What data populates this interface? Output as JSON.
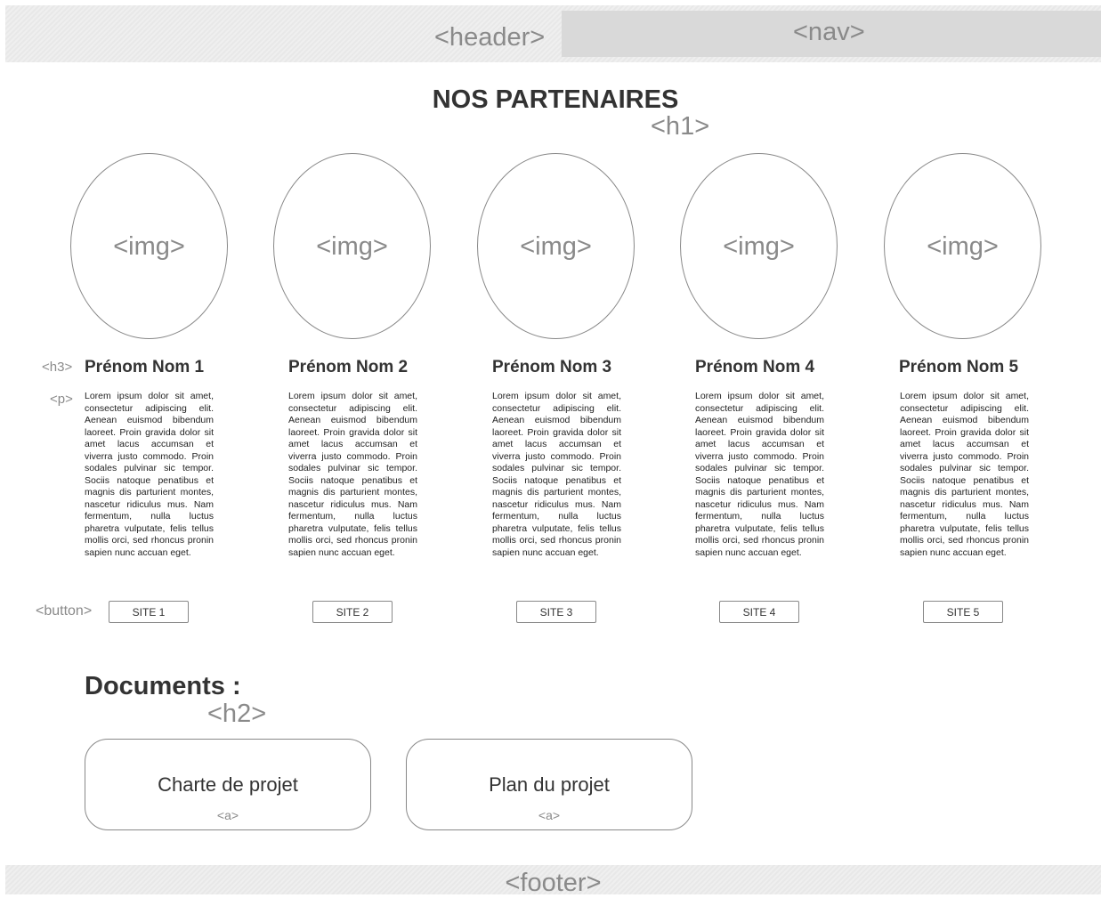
{
  "header": {
    "tag": "<header>"
  },
  "nav": {
    "tag": "<nav>"
  },
  "page": {
    "title": "NOS PARTENAIRES",
    "title_tag": "<h1>"
  },
  "annotations": {
    "h3": "<h3>",
    "p": "<p>",
    "button": "<button>"
  },
  "partners": [
    {
      "image_tag": "<img>",
      "name": "Prénom Nom 1",
      "text": "Lorem ipsum dolor sit amet, consectetur adipiscing elit. Aenean euismod bibendum laoreet. Proin gravida dolor sit amet lacus accumsan et viverra justo commodo. Proin sodales pulvinar sic tempor. Sociis natoque penatibus et magnis dis parturient montes, nascetur ridiculus mus. Nam fermentum, nulla luctus pharetra vulputate, felis tellus mollis orci, sed rhoncus pronin sapien nunc accuan eget.",
      "button": "SITE 1"
    },
    {
      "image_tag": "<img>",
      "name": "Prénom Nom 2",
      "text": "Lorem ipsum dolor sit amet, consectetur adipiscing elit. Aenean euismod bibendum laoreet. Proin gravida dolor sit amet lacus accumsan et viverra justo commodo. Proin sodales pulvinar sic tempor. Sociis natoque penatibus et magnis dis parturient montes, nascetur ridiculus mus. Nam fermentum, nulla luctus pharetra vulputate, felis tellus mollis orci, sed rhoncus pronin sapien nunc accuan eget.",
      "button": "SITE 2"
    },
    {
      "image_tag": "<img>",
      "name": "Prénom Nom 3",
      "text": "Lorem ipsum dolor sit amet, consectetur adipiscing elit. Aenean euismod bibendum laoreet. Proin gravida dolor sit amet lacus accumsan et viverra justo commodo. Proin sodales pulvinar sic tempor. Sociis natoque penatibus et magnis dis parturient montes, nascetur ridiculus mus. Nam fermentum, nulla luctus pharetra vulputate, felis tellus mollis orci, sed rhoncus pronin sapien nunc accuan eget.",
      "button": "SITE 3"
    },
    {
      "image_tag": "<img>",
      "name": "Prénom Nom 4",
      "text": "Lorem ipsum dolor sit amet, consectetur adipiscing elit. Aenean euismod bibendum laoreet. Proin gravida dolor sit amet lacus accumsan et viverra justo commodo. Proin sodales pulvinar sic tempor. Sociis natoque penatibus et magnis dis parturient montes, nascetur ridiculus mus. Nam fermentum, nulla luctus pharetra vulputate, felis tellus mollis orci, sed rhoncus pronin sapien nunc accuan eget.",
      "button": "SITE 4"
    },
    {
      "image_tag": "<img>",
      "name": "Prénom Nom 5",
      "text": "Lorem ipsum dolor sit amet, consectetur adipiscing elit. Aenean euismod bibendum laoreet. Proin gravida dolor sit amet lacus accumsan et viverra justo commodo. Proin sodales pulvinar sic tempor. Sociis natoque penatibus et magnis dis parturient montes, nascetur ridiculus mus. Nam fermentum, nulla luctus pharetra vulputate, felis tellus mollis orci, sed rhoncus pronin sapien nunc accuan eget.",
      "button": "SITE 5"
    }
  ],
  "documents": {
    "title": "Documents :",
    "title_tag": "<h2>",
    "links": [
      {
        "label": "Charte de projet",
        "tag": "<a>"
      },
      {
        "label": "Plan du projet",
        "tag": "<a>"
      }
    ]
  },
  "footer": {
    "tag": "<footer>"
  }
}
